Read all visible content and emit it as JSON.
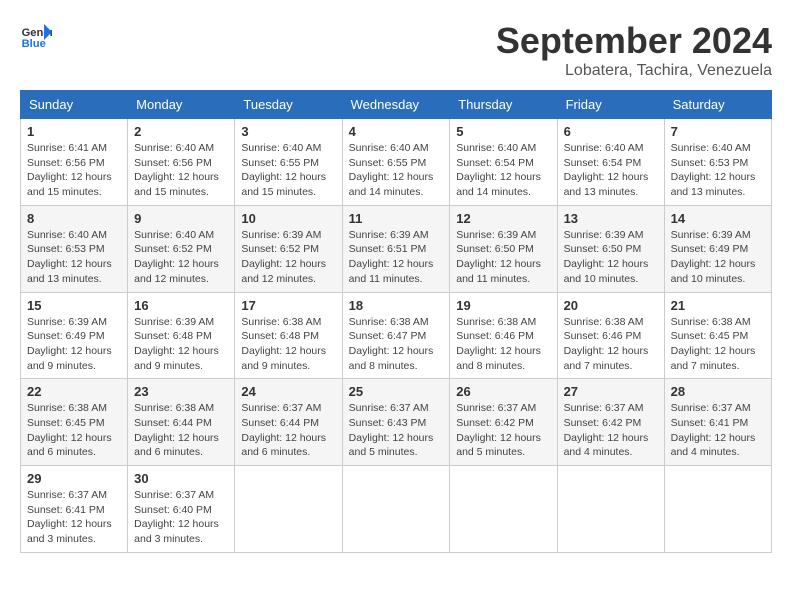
{
  "header": {
    "logo_line1": "General",
    "logo_line2": "Blue",
    "month_year": "September 2024",
    "location": "Lobatera, Tachira, Venezuela"
  },
  "days_of_week": [
    "Sunday",
    "Monday",
    "Tuesday",
    "Wednesday",
    "Thursday",
    "Friday",
    "Saturday"
  ],
  "weeks": [
    [
      {
        "day": "1",
        "sunrise": "6:41 AM",
        "sunset": "6:56 PM",
        "daylight": "12 hours and 15 minutes."
      },
      {
        "day": "2",
        "sunrise": "6:40 AM",
        "sunset": "6:56 PM",
        "daylight": "12 hours and 15 minutes."
      },
      {
        "day": "3",
        "sunrise": "6:40 AM",
        "sunset": "6:55 PM",
        "daylight": "12 hours and 15 minutes."
      },
      {
        "day": "4",
        "sunrise": "6:40 AM",
        "sunset": "6:55 PM",
        "daylight": "12 hours and 14 minutes."
      },
      {
        "day": "5",
        "sunrise": "6:40 AM",
        "sunset": "6:54 PM",
        "daylight": "12 hours and 14 minutes."
      },
      {
        "day": "6",
        "sunrise": "6:40 AM",
        "sunset": "6:54 PM",
        "daylight": "12 hours and 13 minutes."
      },
      {
        "day": "7",
        "sunrise": "6:40 AM",
        "sunset": "6:53 PM",
        "daylight": "12 hours and 13 minutes."
      }
    ],
    [
      {
        "day": "8",
        "sunrise": "6:40 AM",
        "sunset": "6:53 PM",
        "daylight": "12 hours and 13 minutes."
      },
      {
        "day": "9",
        "sunrise": "6:40 AM",
        "sunset": "6:52 PM",
        "daylight": "12 hours and 12 minutes."
      },
      {
        "day": "10",
        "sunrise": "6:39 AM",
        "sunset": "6:52 PM",
        "daylight": "12 hours and 12 minutes."
      },
      {
        "day": "11",
        "sunrise": "6:39 AM",
        "sunset": "6:51 PM",
        "daylight": "12 hours and 11 minutes."
      },
      {
        "day": "12",
        "sunrise": "6:39 AM",
        "sunset": "6:50 PM",
        "daylight": "12 hours and 11 minutes."
      },
      {
        "day": "13",
        "sunrise": "6:39 AM",
        "sunset": "6:50 PM",
        "daylight": "12 hours and 10 minutes."
      },
      {
        "day": "14",
        "sunrise": "6:39 AM",
        "sunset": "6:49 PM",
        "daylight": "12 hours and 10 minutes."
      }
    ],
    [
      {
        "day": "15",
        "sunrise": "6:39 AM",
        "sunset": "6:49 PM",
        "daylight": "12 hours and 9 minutes."
      },
      {
        "day": "16",
        "sunrise": "6:39 AM",
        "sunset": "6:48 PM",
        "daylight": "12 hours and 9 minutes."
      },
      {
        "day": "17",
        "sunrise": "6:38 AM",
        "sunset": "6:48 PM",
        "daylight": "12 hours and 9 minutes."
      },
      {
        "day": "18",
        "sunrise": "6:38 AM",
        "sunset": "6:47 PM",
        "daylight": "12 hours and 8 minutes."
      },
      {
        "day": "19",
        "sunrise": "6:38 AM",
        "sunset": "6:46 PM",
        "daylight": "12 hours and 8 minutes."
      },
      {
        "day": "20",
        "sunrise": "6:38 AM",
        "sunset": "6:46 PM",
        "daylight": "12 hours and 7 minutes."
      },
      {
        "day": "21",
        "sunrise": "6:38 AM",
        "sunset": "6:45 PM",
        "daylight": "12 hours and 7 minutes."
      }
    ],
    [
      {
        "day": "22",
        "sunrise": "6:38 AM",
        "sunset": "6:45 PM",
        "daylight": "12 hours and 6 minutes."
      },
      {
        "day": "23",
        "sunrise": "6:38 AM",
        "sunset": "6:44 PM",
        "daylight": "12 hours and 6 minutes."
      },
      {
        "day": "24",
        "sunrise": "6:37 AM",
        "sunset": "6:44 PM",
        "daylight": "12 hours and 6 minutes."
      },
      {
        "day": "25",
        "sunrise": "6:37 AM",
        "sunset": "6:43 PM",
        "daylight": "12 hours and 5 minutes."
      },
      {
        "day": "26",
        "sunrise": "6:37 AM",
        "sunset": "6:42 PM",
        "daylight": "12 hours and 5 minutes."
      },
      {
        "day": "27",
        "sunrise": "6:37 AM",
        "sunset": "6:42 PM",
        "daylight": "12 hours and 4 minutes."
      },
      {
        "day": "28",
        "sunrise": "6:37 AM",
        "sunset": "6:41 PM",
        "daylight": "12 hours and 4 minutes."
      }
    ],
    [
      {
        "day": "29",
        "sunrise": "6:37 AM",
        "sunset": "6:41 PM",
        "daylight": "12 hours and 3 minutes."
      },
      {
        "day": "30",
        "sunrise": "6:37 AM",
        "sunset": "6:40 PM",
        "daylight": "12 hours and 3 minutes."
      },
      null,
      null,
      null,
      null,
      null
    ]
  ]
}
